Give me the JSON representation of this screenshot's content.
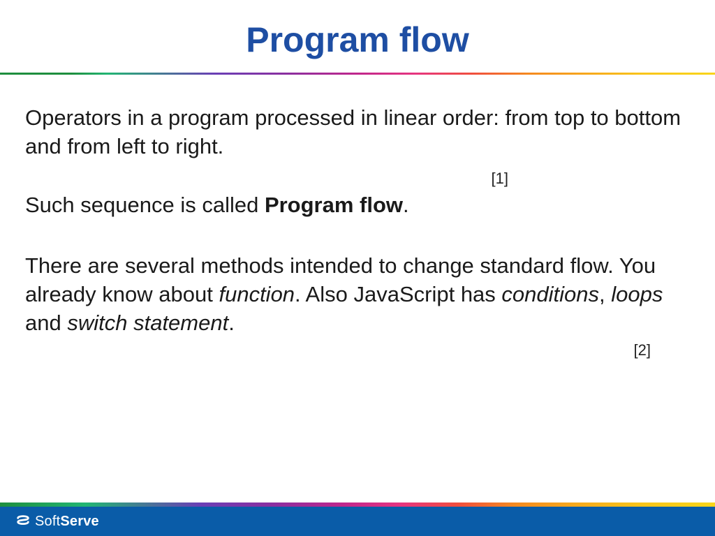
{
  "slide": {
    "title": "Program flow",
    "para1": "Operators in a program processed in linear order: from top to bottom and from left to right.",
    "ref1": "[1]",
    "para2_pre": "Such sequence is called ",
    "para2_bold": "Program flow",
    "para2_post": ".",
    "para3_a": "There are several methods intended to change standard flow. You already know about ",
    "para3_i1": "function",
    "para3_b": ". Also JavaScript has ",
    "para3_i2": "conditions",
    "para3_c": ", ",
    "para3_i3": "loops",
    "para3_d": " and ",
    "para3_i4": "switch statement",
    "para3_e": ".",
    "ref2": "[2]"
  },
  "footer": {
    "brand_soft": "Soft",
    "brand_serve": "Serve"
  }
}
